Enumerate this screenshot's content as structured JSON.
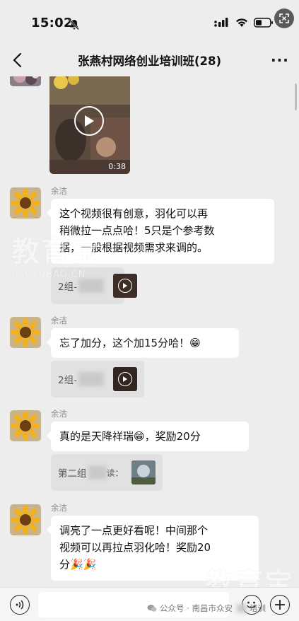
{
  "status": {
    "time": "15:02"
  },
  "title_bar": {
    "back_label": "<",
    "title": "张燕村网络创业培训班(28)",
    "more_label": "···"
  },
  "video": {
    "duration": "0:38"
  },
  "messages": [
    {
      "sender": "余洁",
      "text": "这个视频很有创意，羽化可以再稍微拉一点点哈！5只是个参考数据，一般根据视频需求来调的。",
      "lines": [
        "这个视频很有创意，羽化可以再",
        "稍微拉一点点哈！5只是个参考数",
        "据，一般根据视频需求来调的。"
      ],
      "quote": "2组-"
    },
    {
      "sender": "余洁",
      "text": "忘了加分，这个加15分哈！😁",
      "quote": "2组-"
    },
    {
      "sender": "余洁",
      "text": "真的是天降祥瑞😁，奖励20分",
      "quote": "第二组",
      "quote_suffix": "读："
    },
    {
      "sender": "余洁",
      "lines": [
        "调亮了一点更好看呢！中间那个",
        "视频可以再拉点羽化哈！奖励20",
        "分🎉🎉"
      ]
    }
  ],
  "watermarks": {
    "big": "教育宝",
    "small": "JIAOYUBAO.CN"
  },
  "footer": {
    "source": "公众号 · 南昌市众安",
    "source_suffix": "培训"
  }
}
